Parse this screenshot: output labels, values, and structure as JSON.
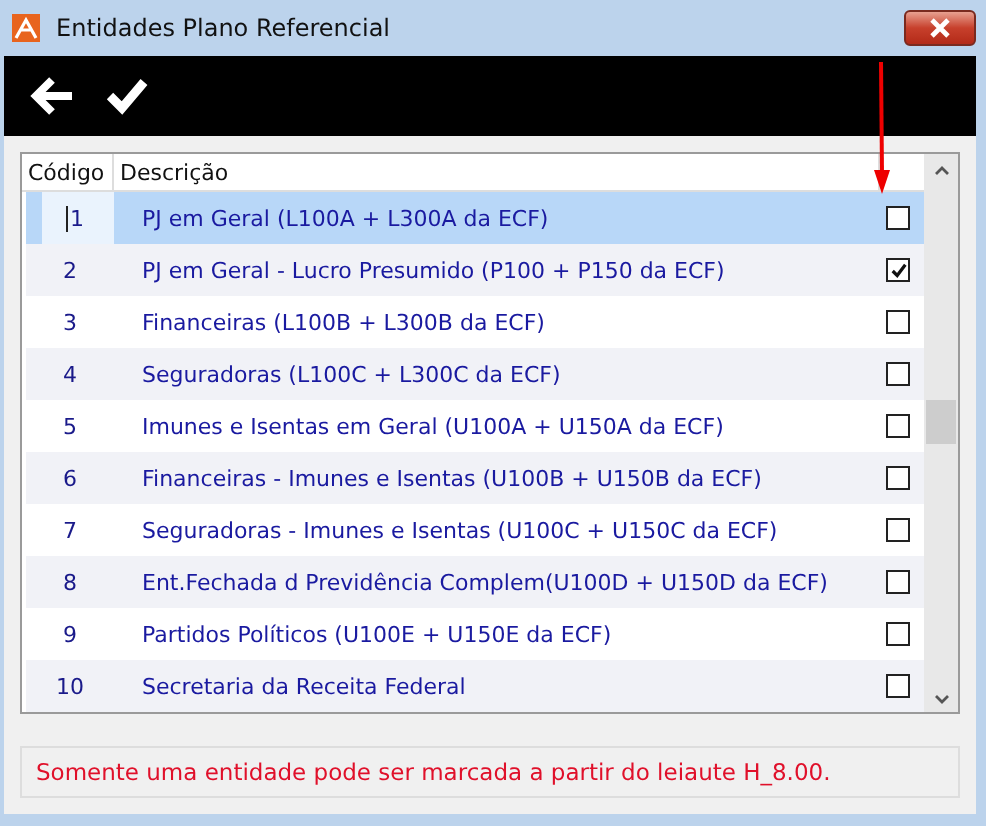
{
  "window": {
    "title": "Entidades Plano Referencial"
  },
  "toolbar": [
    {
      "kind": "back"
    },
    {
      "kind": "confirm"
    }
  ],
  "table": {
    "columns": [
      "Código",
      "Descrição"
    ],
    "rows": [
      {
        "code": "1",
        "description": "PJ em Geral (L100A + L300A da ECF)",
        "checked": false,
        "selected": true
      },
      {
        "code": "2",
        "description": "PJ em Geral - Lucro Presumido (P100 + P150 da ECF)",
        "checked": true,
        "selected": false
      },
      {
        "code": "3",
        "description": "Financeiras (L100B + L300B da ECF)",
        "checked": false,
        "selected": false
      },
      {
        "code": "4",
        "description": "Seguradoras (L100C + L300C da ECF)",
        "checked": false,
        "selected": false
      },
      {
        "code": "5",
        "description": "Imunes e Isentas em Geral (U100A + U150A da ECF)",
        "checked": false,
        "selected": false
      },
      {
        "code": "6",
        "description": "Financeiras - Imunes e Isentas (U100B + U150B da ECF)",
        "checked": false,
        "selected": false
      },
      {
        "code": "7",
        "description": "Seguradoras - Imunes e Isentas (U100C + U150C da ECF)",
        "checked": false,
        "selected": false
      },
      {
        "code": "8",
        "description": "Ent.Fechada d Previdência Complem(U100D + U150D da ECF)",
        "checked": false,
        "selected": false
      },
      {
        "code": "9",
        "description": "Partidos Políticos (U100E + U150E da ECF)",
        "checked": false,
        "selected": false
      },
      {
        "code": "10",
        "description": "Secretaria da Receita Federal",
        "checked": false,
        "selected": false
      }
    ]
  },
  "message": "Somente uma entidade pode ser marcada a partir do leiaute H_8.00."
}
